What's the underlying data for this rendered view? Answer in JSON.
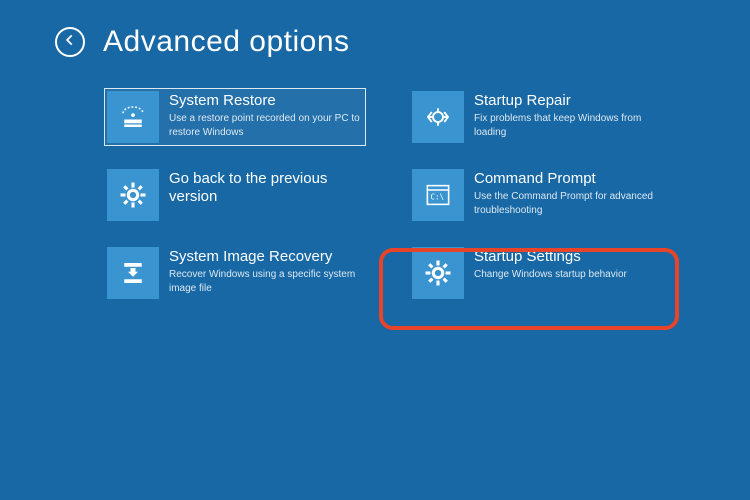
{
  "page_title": "Advanced options",
  "tiles": [
    {
      "id": "system-restore",
      "title": "System Restore",
      "desc": "Use a restore point recorded on your PC to restore Windows",
      "selected": true
    },
    {
      "id": "startup-repair",
      "title": "Startup Repair",
      "desc": "Fix problems that keep Windows from loading",
      "selected": false
    },
    {
      "id": "go-back",
      "title": "Go back to the previous version",
      "desc": "",
      "selected": false
    },
    {
      "id": "command-prompt",
      "title": "Command Prompt",
      "desc": "Use the Command Prompt for advanced troubleshooting",
      "selected": false
    },
    {
      "id": "system-image-recovery",
      "title": "System Image Recovery",
      "desc": "Recover Windows using a specific system image file",
      "selected": false
    },
    {
      "id": "startup-settings",
      "title": "Startup Settings",
      "desc": "Change Windows startup behavior",
      "selected": false,
      "highlighted": true
    }
  ]
}
